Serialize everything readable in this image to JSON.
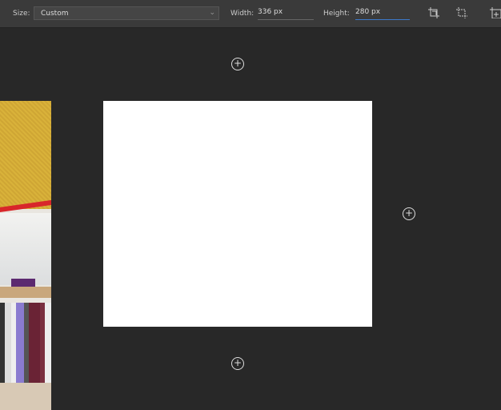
{
  "toolbar": {
    "size_label": "Size:",
    "size_value": "Custom",
    "width_label": "Width:",
    "width_value": "336 px",
    "height_label": "Height:",
    "height_value": "280 px"
  },
  "icons": [
    "crop-to-content-icon",
    "crop-icon",
    "add-artboard-icon"
  ]
}
